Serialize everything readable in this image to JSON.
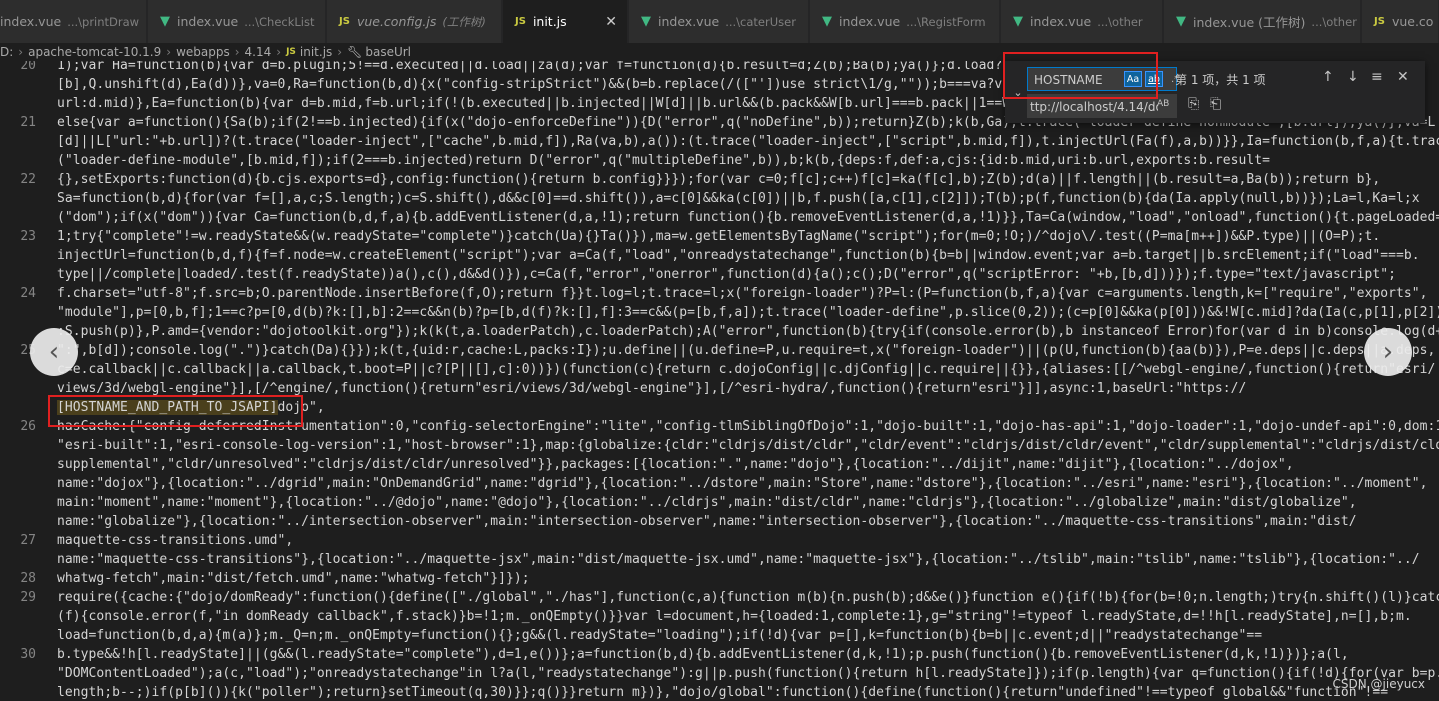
{
  "tabs": [
    {
      "icon": "vue-icon",
      "name": "index.vue",
      "desc": "...\\printDraw",
      "active": false,
      "italic": false
    },
    {
      "icon": "vue-icon",
      "name": "index.vue",
      "desc": "...\\CheckList",
      "active": false,
      "italic": false
    },
    {
      "icon": "js-icon",
      "name": "vue.config.js",
      "desc": "(工作树)",
      "active": false,
      "italic": true
    },
    {
      "icon": "js-icon",
      "name": "init.js",
      "desc": "",
      "active": true,
      "italic": false,
      "close": "✕"
    },
    {
      "icon": "vue-icon",
      "name": "index.vue",
      "desc": "...\\caterUser",
      "active": false,
      "italic": false
    },
    {
      "icon": "vue-icon",
      "name": "index.vue",
      "desc": "...\\RegistForm",
      "active": false,
      "italic": false
    },
    {
      "icon": "vue-icon",
      "name": "index.vue",
      "desc": "...\\other",
      "active": false,
      "italic": false
    },
    {
      "icon": "vue-icon",
      "name": "index.vue (工作树)",
      "desc": "...\\other",
      "active": false,
      "italic": false
    },
    {
      "icon": "js-icon",
      "name": "vue.co",
      "desc": "",
      "active": false,
      "italic": false
    }
  ],
  "breadcrumb": {
    "parts": [
      "D:",
      "apache-tomcat-10.1.9",
      "webapps",
      "4.14"
    ],
    "file": "init.js",
    "symbol": "baseUrl"
  },
  "line_numbers": [
    "20",
    "21",
    "22",
    "23",
    "24",
    "25",
    "26",
    "27",
    "28",
    "29",
    "30"
  ],
  "code_lines": [
    "1);var Ha=function(b){var d=b.plugin;5!==d.executed||d.load||za(d);var f=function(d){b.result=d;Z(b);Ba(b);ya()};d.load?d.l",
    "[b],Q.unshift(d),Ea(d))},va=0,Ra=function(b,d){x(\"config-stripStrict\")&&(b=b.replace(/([\"'])use strict\\1/g,\"\"));b===va?va.c",
    "url:d.mid)},Ea=function(b){var d=b.mid,f=b.url;if(!(b.executed||b.injected||W[d]||b.url&&(b.pack&&W[b.url]===b.pack||1==W[b",
    "else{var a=function(){Sa(b);if(2!==b.injected){if(x(\"dojo-enforceDefine\")){D(\"error\",q(\"noDefine\",b));return}Z(b);k(b,Ga);t.trace(\"loader-define-nonmodule\",[b.url]);ya()},va=L",
    "[d]||L[\"url:\"+b.url])?(t.trace(\"loader-inject\",[\"cache\",b.mid,f]),Ra(va,b),a()):(t.trace(\"loader-inject\",[\"script\",b.mid,f]),t.injectUrl(Fa(f),a,b))}},Ia=function(b,f,a){t.trace",
    "(\"loader-define-module\",[b.mid,f]);if(2===b.injected)return D(\"error\",q(\"multipleDefine\",b)),b;k(b,{deps:f,def:a,cjs:{id:b.mid,uri:b.url,exports:b.result=",
    "{},setExports:function(d){b.cjs.exports=d},config:function(){return b.config}}});for(var c=0;f[c];c++)f[c]=ka(f[c],b);Z(b);d(a)||f.length||(b.result=a,Ba(b));return b},",
    "Sa=function(b,d){for(var f=[],a,c;S.length;)c=S.shift(),d&&c[0]==d.shift()),a=c[0]&&ka(c[0])||b,f.push([a,c[1],c[2]]);T(b);p(f,function(b){da(Ia.apply(null,b))});La=l,Ka=l;x",
    "(\"dom\");if(x(\"dom\")){var Ca=function(b,d,f,a){b.addEventListener(d,a,!1);return function(){b.removeEventListener(d,a,!1)}},Ta=Ca(window,\"load\",\"onload\",function(){t.pageLoaded=",
    "1;try{\"complete\"!=w.readyState&&(w.readyState=\"complete\")}catch(Ua){}Ta()}),ma=w.getElementsByTagName(\"script\");for(m=0;!O;)/^dojo\\/.test((P=ma[m++])&&P.type)||(O=P);t.",
    "injectUrl=function(b,d,f){f=f.node=w.createElement(\"script\");var a=Ca(f,\"load\",\"onreadystatechange\",function(b){b=b||window.event;var a=b.target||b.srcElement;if(\"load\"===b.",
    "type||/complete|loaded/.test(f.readyState))a(),c(),d&&d()}),c=Ca(f,\"error\",\"onerror\",function(d){a();c();D(\"error\",q(\"scriptError: \"+b,[b,d]))});f.type=\"text/javascript\";",
    "f.charset=\"utf-8\";f.src=b;O.parentNode.insertBefore(f,O);return f}}t.log=l;t.trace=l;x(\"foreign-loader\")?P=l:(P=function(b,f,a){var c=arguments.length,k=[\"require\",\"exports\",",
    "\"module\"],p=[0,b,f];1==c?p=[0,d(b)?k:[],b]:2==c&&n(b)?p=[b,d(f)?k:[],f]:3==c&&(p=[b,f,a]);t.trace(\"loader-define\",p.slice(0,2));(c=p[0]&&ka(p[0]))&&!W[c.mid]?da(Ia(c,p[1],p[2]))",
    ":S.push(p)},P.amd={vendor:\"dojotoolkit.org\"});k(k(t,a.loaderPatch),c.loaderPatch);A(\"error\",function(b){try{if(console.error(b),b instanceof Error)for(var d in b)console.log(d+",
    "\":\",b[d]);console.log(\".\")}catch(Da){}});k(t,{uid:r,cache:L,packs:I});u.define||(u.define=P,u.require=t,x(\"foreign-loader\")||(p(U,function(b){aa(b)}),P=e.deps||c.deps||a.deps,",
    "c=e.callback||c.callback||a.callback,t.boot=P||c?[P||[],c]:0))})(function(c){return c.dojoConfig||c.djConfig||c.require||{}},{aliases:[[/^webgl-engine/,function(){return\"esri/",
    "views/3d/webgl-engine\"}],[/^engine/,function(){return\"esri/views/3d/webgl-engine\"}],[/^esri-hydra/,function(){return\"esri\"}]],async:1,baseUrl:\"https://",
    "[HOSTNAME_AND_PATH_TO_JSAPI]dojo\",",
    "hasCache:{\"config-deferredInstrumentation\":0,\"config-selectorEngine\":\"lite\",\"config-tlmSiblingOfDojo\":1,\"dojo-built\":1,\"dojo-has-api\":1,\"dojo-loader\":1,\"dojo-undef-api\":0,dom:1,",
    "\"esri-built\":1,\"esri-console-log-version\":1,\"host-browser\":1},map:{globalize:{cldr:\"cldrjs/dist/cldr\",\"cldr/event\":\"cldrjs/dist/cldr/event\",\"cldr/supplemental\":\"cldrjs/dist/cldr/",
    "supplemental\",\"cldr/unresolved\":\"cldrjs/dist/cldr/unresolved\"}},packages:[{location:\".\",name:\"dojo\"},{location:\"../dijit\",name:\"dijit\"},{location:\"../dojox\",",
    "name:\"dojox\"},{location:\"../dgrid\",main:\"OnDemandGrid\",name:\"dgrid\"},{location:\"../dstore\",main:\"Store\",name:\"dstore\"},{location:\"../esri\",name:\"esri\"},{location:\"../moment\",",
    "main:\"moment\",name:\"moment\"},{location:\"../@dojo\",name:\"@dojo\"},{location:\"../cldrjs\",main:\"dist/cldr\",name:\"cldrjs\"},{location:\"../globalize\",main:\"dist/globalize\",",
    "name:\"globalize\"},{location:\"../intersection-observer\",main:\"intersection-observer\",name:\"intersection-observer\"},{location:\"../maquette-css-transitions\",main:\"dist/",
    "maquette-css-transitions.umd\",",
    "name:\"maquette-css-transitions\"},{location:\"../maquette-jsx\",main:\"dist/maquette-jsx.umd\",name:\"maquette-jsx\"},{location:\"../tslib\",main:\"tslib\",name:\"tslib\"},{location:\"../",
    "whatwg-fetch\",main:\"dist/fetch.umd\",name:\"whatwg-fetch\"}]});",
    "require({cache:{\"dojo/domReady\":function(){define([\"./global\",\"./has\"],function(c,a){function m(b){n.push(b);d&&e()}function e(){if(!b){for(b=!0;n.length;)try{n.shift()(l)}catch",
    "(f){console.error(f,\"in domReady callback\",f.stack)}b=!1;m._onQEmpty()}}var l=document,h={loaded:1,complete:1},g=\"string\"!=typeof l.readyState,d=!!h[l.readyState],n=[],b;m.",
    "load=function(b,d,a){m(a)};m._Q=n;m._onQEmpty=function(){};g&&(l.readyState=\"loading\");if(!d){var p=[],k=function(b){b=b||c.event;d||\"readystatechange\"==",
    "b.type&&!h[l.readyState]||(g&&(l.readyState=\"complete\"),d=1,e())};a=function(b,d){b.addEventListener(d,k,!1);p.push(function(){b.removeEventListener(d,k,!1)})};a(l,",
    "\"DOMContentLoaded\");a(c,\"load\");\"onreadystatechange\"in l?a(l,\"readystatechange\"):g||p.push(function(){return h[l.readyState]});if(p.length){var q=function(){if(!d){for(var b=p.",
    "length;b--;)if(p[b]()){k(\"poller\");return}setTimeout(q,30)}};q()}}return m})},\"dojo/global\":function(){define(function(){return\"undefined\"!==typeof global&&\"function\"!=="
  ],
  "find_widget": {
    "find_value": "HOSTNAME",
    "match_case": "Aa",
    "whole_word": "ab",
    "regex": ".*",
    "match_count": "第 1 项，共 1 项",
    "replace_value": "ttp://localhost/4.14/dojo",
    "preserve_case": "AB"
  },
  "nav": {
    "prev": "‹",
    "next": "›"
  },
  "watermark": "CSDN @jieyucx",
  "colors": {
    "editor_bg": "#1e1e1e",
    "tab_bg": "#252526",
    "annotation_red": "#e02020",
    "vue_green": "#41b883",
    "js_yellow": "#cbcb41",
    "accent": "#007acc"
  }
}
